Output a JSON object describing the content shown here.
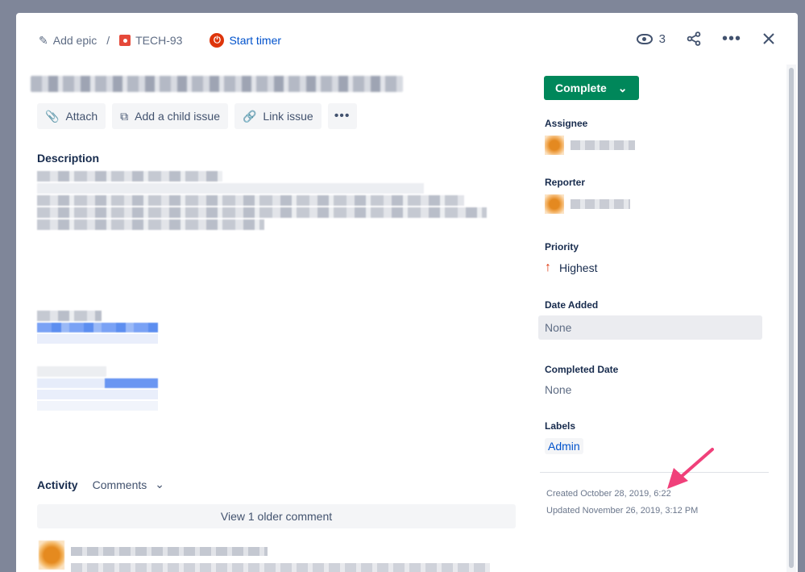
{
  "breadcrumb": {
    "epic_label": "Add epic",
    "separator": "/",
    "issue_key": "TECH-93"
  },
  "timer": {
    "label": "Start timer"
  },
  "header": {
    "watch_count": "3"
  },
  "actions": {
    "attach": "Attach",
    "add_child": "Add a child issue",
    "link_issue": "Link issue"
  },
  "description": {
    "label": "Description"
  },
  "activity": {
    "label": "Activity",
    "filter": "Comments",
    "older_comments": "View 1 older comment"
  },
  "status": {
    "label": "Complete"
  },
  "fields": {
    "assignee_label": "Assignee",
    "reporter_label": "Reporter",
    "priority_label": "Priority",
    "priority_value": "Highest",
    "date_added_label": "Date Added",
    "date_added_value": "None",
    "completed_label": "Completed Date",
    "completed_value": "None",
    "labels_label": "Labels",
    "labels_value": "Admin"
  },
  "meta": {
    "created": "Created October 28, 2019, 6:22",
    "updated": "Updated November 26, 2019, 3:12 PM"
  },
  "colors": {
    "accent_green": "#00875a",
    "link_blue": "#0052cc",
    "pointer_pink": "#f0407a"
  }
}
